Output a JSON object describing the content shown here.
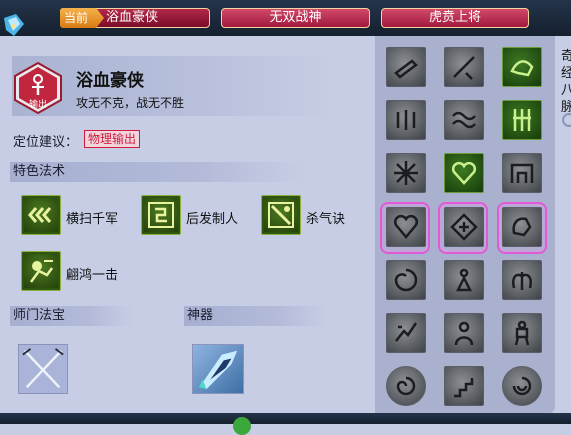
{
  "tabs": {
    "current_flag": "当前",
    "current_name": "浴血豪侠",
    "second": "无双战神",
    "third": "虎贲上将"
  },
  "hero": {
    "badge_text": "输出",
    "name": "浴血豪侠",
    "description": "攻无不克，战无不胜"
  },
  "positioning": {
    "label": "定位建议：",
    "value": "物理输出"
  },
  "skills_section": {
    "title": "特色法术",
    "skills": [
      {
        "name": "横扫千军",
        "icon": "chevron-slash-icon"
      },
      {
        "name": "后发制人",
        "icon": "counter-strike-icon"
      },
      {
        "name": "杀气诀",
        "icon": "killing-aura-icon"
      },
      {
        "name": "翩鸿一击",
        "icon": "swift-strike-icon"
      }
    ]
  },
  "treasure_section": {
    "title": "师门法宝",
    "item_icon": "crossed-swords-icon"
  },
  "artifact_section": {
    "title": "神器",
    "item_icon": "spear-artifact-icon"
  },
  "side_text": "奇经八脉",
  "colors": {
    "tab_bg": "#a0193b",
    "current_flag": "#f5b24a",
    "position_accent": "#d01c3e",
    "skill_green": "#3d7a22",
    "selection_pink": "#e05ad8"
  },
  "grid_icons": [
    [
      "cannon-icon",
      "sword-strike-icon",
      "dragon-icon"
    ],
    [
      "raining-blade-icon",
      "wave-icon",
      "bamboo-icon"
    ],
    [
      "burst-icon",
      "heart-icon",
      "fortress-icon"
    ],
    [
      "heart-shield-icon",
      "gate-rune-icon",
      "fist-icon"
    ],
    [
      "swirl-orb-icon",
      "meditating-figure-icon",
      "wings-icon"
    ],
    [
      "dash-strike-icon",
      "warrior-bust-icon",
      "warrior-stance-icon"
    ],
    [
      "coin-swirl-icon",
      "stairs-icon",
      "coin-knot-icon"
    ]
  ]
}
